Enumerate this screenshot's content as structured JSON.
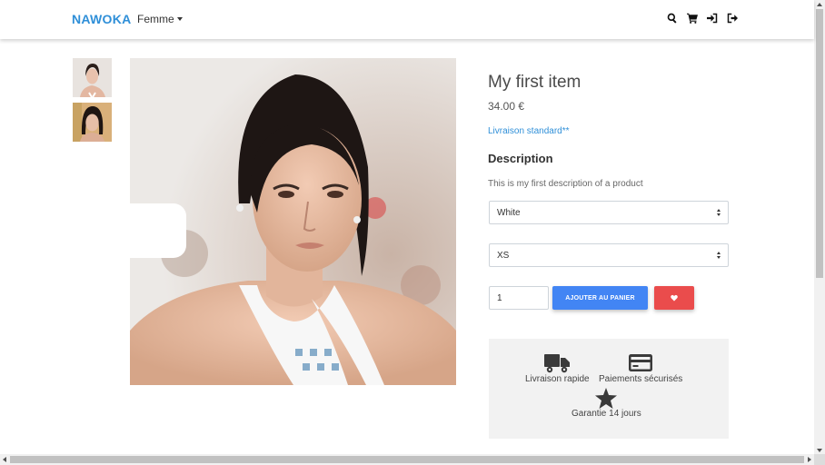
{
  "navbar": {
    "brand": "NAWOKA",
    "menu_label": "Femme",
    "icons": [
      "search-icon",
      "cart-icon",
      "sign-in-icon",
      "sign-out-icon"
    ]
  },
  "gallery": {
    "thumbnails": [
      "thumbnail-1",
      "thumbnail-2"
    ]
  },
  "product": {
    "title": "My first item",
    "price": "34.00 €",
    "shipping_link": "Livraison standard**",
    "description_title": "Description",
    "description": "This is my first description of a product",
    "color_select": "White",
    "size_select": "XS",
    "quantity": "1",
    "add_to_cart": "AJOUTER AU PANIER"
  },
  "features": {
    "fast_delivery": "Livraison rapide",
    "secure_payment": "Paiements sécurisés",
    "guarantee": "Garantie 14 jours"
  },
  "colors": {
    "brand": "#2f8fd8",
    "primary_button": "#4285f4",
    "favorite_button": "#ea4c4c",
    "features_bg": "#f2f2f2"
  }
}
